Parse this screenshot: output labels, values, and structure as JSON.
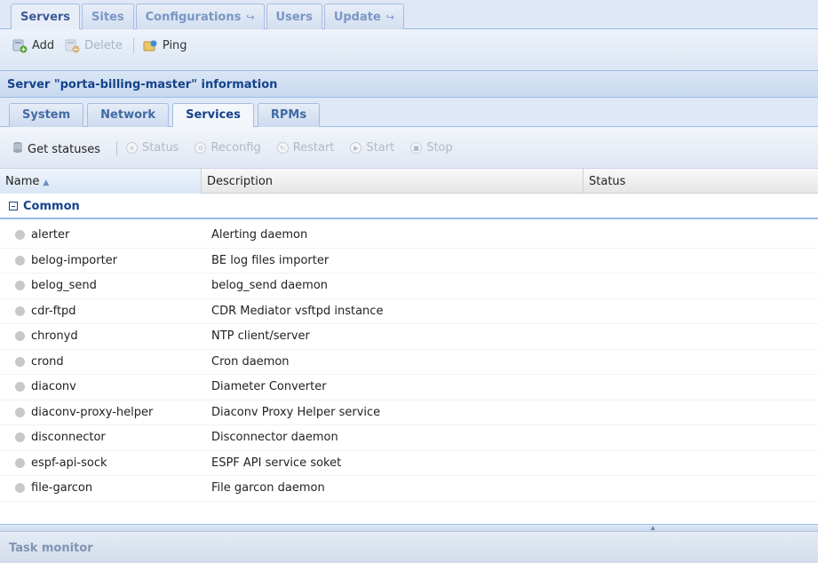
{
  "top_tabs": [
    {
      "label": "Servers",
      "active": true
    },
    {
      "label": "Sites",
      "active": false
    },
    {
      "label": "Configurations",
      "arrow": "↪",
      "active": false
    },
    {
      "label": "Users",
      "active": false
    },
    {
      "label": "Update",
      "arrow": "↪",
      "active": false
    }
  ],
  "toolbar": {
    "add_label": "Add",
    "delete_label": "Delete",
    "ping_label": "Ping"
  },
  "panel": {
    "title": "Server \"porta-billing-master\" information"
  },
  "inner_tabs": [
    {
      "label": "System",
      "active": false
    },
    {
      "label": "Network",
      "active": false
    },
    {
      "label": "Services",
      "active": true
    },
    {
      "label": "RPMs",
      "active": false
    }
  ],
  "services_toolbar": {
    "get_statuses": "Get statuses",
    "status": "Status",
    "reconfig": "Reconfig",
    "restart": "Restart",
    "start": "Start",
    "stop": "Stop"
  },
  "grid": {
    "columns": {
      "name": "Name",
      "description": "Description",
      "status": "Status"
    },
    "group": "Common",
    "rows": [
      {
        "name": "alerter",
        "description": "Alerting daemon",
        "status": ""
      },
      {
        "name": "belog-importer",
        "description": "BE log files importer",
        "status": ""
      },
      {
        "name": "belog_send",
        "description": "belog_send daemon",
        "status": ""
      },
      {
        "name": "cdr-ftpd",
        "description": "CDR Mediator vsftpd instance",
        "status": ""
      },
      {
        "name": "chronyd",
        "description": "NTP client/server",
        "status": ""
      },
      {
        "name": "crond",
        "description": "Cron daemon",
        "status": ""
      },
      {
        "name": "diaconv",
        "description": "Diameter Converter",
        "status": ""
      },
      {
        "name": "diaconv-proxy-helper",
        "description": "Diaconv Proxy Helper service",
        "status": ""
      },
      {
        "name": "disconnector",
        "description": "Disconnector daemon",
        "status": ""
      },
      {
        "name": "espf-api-sock",
        "description": "ESPF API service soket",
        "status": ""
      },
      {
        "name": "file-garcon",
        "description": "File garcon daemon",
        "status": ""
      }
    ]
  },
  "task_monitor": {
    "title": "Task monitor"
  },
  "colors": {
    "accent": "#15428b",
    "border": "#99bbe8",
    "status_dot": "#c8c8c8"
  }
}
